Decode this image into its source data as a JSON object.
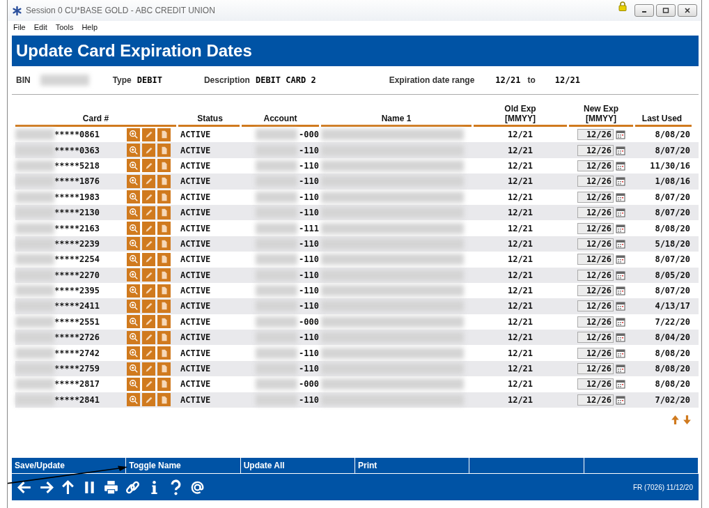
{
  "window": {
    "title": "Session 0 CU*BASE GOLD - ABC CREDIT UNION"
  },
  "menu": [
    "File",
    "Edit",
    "Tools",
    "Help"
  ],
  "page_title": "Update Card Expiration Dates",
  "info": [
    {
      "label": "BIN",
      "redacted": true
    },
    {
      "label": "Type",
      "value": "DEBIT"
    },
    {
      "label": "Description",
      "value": "DEBIT CARD 2"
    },
    {
      "label": "Expiration date range",
      "value": "12/21",
      "joiner": "to",
      "value2": "12/21"
    }
  ],
  "columns": [
    "Card #",
    "Status",
    "Account",
    "Name 1",
    "Old Exp\n[MMYY]",
    "New Exp\n[MMYY]",
    "Last Used"
  ],
  "rows": [
    {
      "card": "*****0861",
      "status": "ACTIVE",
      "account": "-000",
      "old_exp": "12/21",
      "new_exp": "12/26",
      "last_used": "8/08/20"
    },
    {
      "card": "*****0363",
      "status": "ACTIVE",
      "account": "-110",
      "old_exp": "12/21",
      "new_exp": "12/26",
      "last_used": "8/07/20"
    },
    {
      "card": "*****5218",
      "status": "ACTIVE",
      "account": "-110",
      "old_exp": "12/21",
      "new_exp": "12/26",
      "last_used": "11/30/16"
    },
    {
      "card": "*****1876",
      "status": "ACTIVE",
      "account": "-110",
      "old_exp": "12/21",
      "new_exp": "12/26",
      "last_used": "1/08/16"
    },
    {
      "card": "*****1983",
      "status": "ACTIVE",
      "account": "-110",
      "old_exp": "12/21",
      "new_exp": "12/26",
      "last_used": "8/07/20"
    },
    {
      "card": "*****2130",
      "status": "ACTIVE",
      "account": "-110",
      "old_exp": "12/21",
      "new_exp": "12/26",
      "last_used": "8/07/20"
    },
    {
      "card": "*****2163",
      "status": "ACTIVE",
      "account": "-111",
      "old_exp": "12/21",
      "new_exp": "12/26",
      "last_used": "8/08/20"
    },
    {
      "card": "*****2239",
      "status": "ACTIVE",
      "account": "-110",
      "old_exp": "12/21",
      "new_exp": "12/26",
      "last_used": "5/18/20"
    },
    {
      "card": "*****2254",
      "status": "ACTIVE",
      "account": "-110",
      "old_exp": "12/21",
      "new_exp": "12/26",
      "last_used": "8/07/20"
    },
    {
      "card": "*****2270",
      "status": "ACTIVE",
      "account": "-110",
      "old_exp": "12/21",
      "new_exp": "12/26",
      "last_used": "8/05/20"
    },
    {
      "card": "*****2395",
      "status": "ACTIVE",
      "account": "-110",
      "old_exp": "12/21",
      "new_exp": "12/26",
      "last_used": "8/07/20"
    },
    {
      "card": "*****2411",
      "status": "ACTIVE",
      "account": "-110",
      "old_exp": "12/21",
      "new_exp": "12/26",
      "last_used": "4/13/17"
    },
    {
      "card": "*****2551",
      "status": "ACTIVE",
      "account": "-000",
      "old_exp": "12/21",
      "new_exp": "12/26",
      "last_used": "7/22/20"
    },
    {
      "card": "*****2726",
      "status": "ACTIVE",
      "account": "-110",
      "old_exp": "12/21",
      "new_exp": "12/26",
      "last_used": "8/04/20"
    },
    {
      "card": "*****2742",
      "status": "ACTIVE",
      "account": "-110",
      "old_exp": "12/21",
      "new_exp": "12/26",
      "last_used": "8/08/20"
    },
    {
      "card": "*****2759",
      "status": "ACTIVE",
      "account": "-110",
      "old_exp": "12/21",
      "new_exp": "12/26",
      "last_used": "8/08/20"
    },
    {
      "card": "*****2817",
      "status": "ACTIVE",
      "account": "-000",
      "old_exp": "12/21",
      "new_exp": "12/26",
      "last_used": "8/08/20"
    },
    {
      "card": "*****2841",
      "status": "ACTIVE",
      "account": "-110",
      "old_exp": "12/21",
      "new_exp": "12/26",
      "last_used": "7/02/20"
    }
  ],
  "function_keys": [
    "Save/Update",
    "Toggle Name",
    "Update All",
    "Print"
  ],
  "status_bar": "FR (7026) 11/12/20"
}
